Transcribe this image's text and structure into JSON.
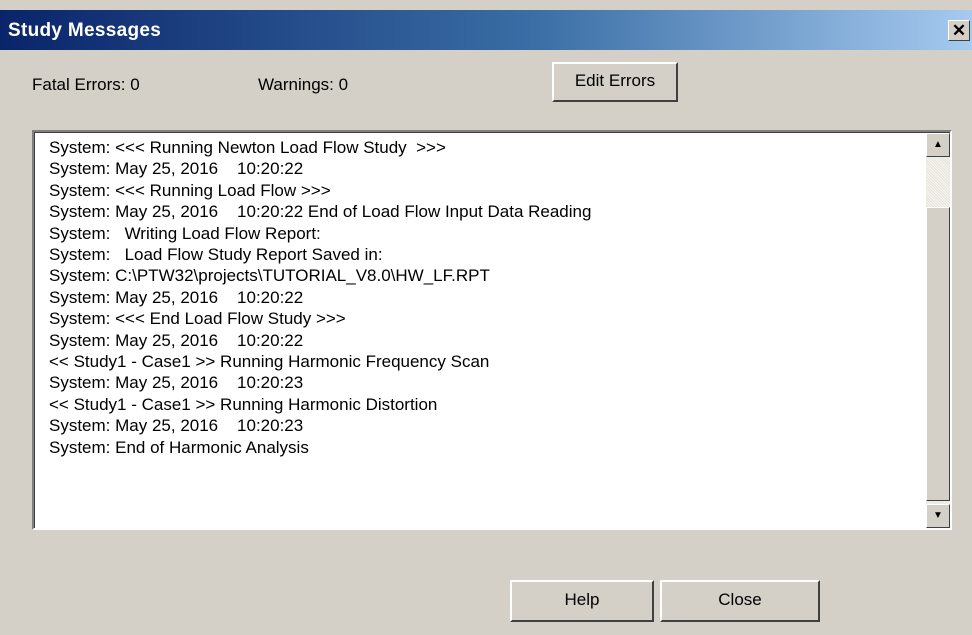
{
  "window": {
    "title": "Study Messages",
    "close_glyph": "✕"
  },
  "stats": {
    "fatal_errors_label": "Fatal Errors:  0",
    "warnings_label": "Warnings:  0"
  },
  "buttons": {
    "edit_errors": "Edit Errors",
    "help": "Help",
    "close": "Close"
  },
  "messages": [
    "System: <<< Running Newton Load Flow Study  >>>",
    "System: May 25, 2016    10:20:22",
    "System: <<< Running Load Flow >>>",
    "System: May 25, 2016    10:20:22 End of Load Flow Input Data Reading",
    "System:   Writing Load Flow Report:",
    "System:   Load Flow Study Report Saved in:",
    "System: C:\\PTW32\\projects\\TUTORIAL_V8.0\\HW_LF.RPT",
    "System: May 25, 2016    10:20:22",
    "System: <<< End Load Flow Study >>>",
    "System: May 25, 2016    10:20:22",
    "<< Study1 - Case1 >> Running Harmonic Frequency Scan",
    "System: May 25, 2016    10:20:23",
    "<< Study1 - Case1 >> Running Harmonic Distortion",
    "System: May 25, 2016    10:20:23",
    "System: End of Harmonic Analysis"
  ],
  "scrollbar": {
    "up_arrow": "▲",
    "down_arrow": "▼"
  },
  "colors": {
    "title_bar_start": "#0a246a",
    "title_bar_end": "#a6caf0",
    "dialog_face": "#d4d0c8"
  }
}
